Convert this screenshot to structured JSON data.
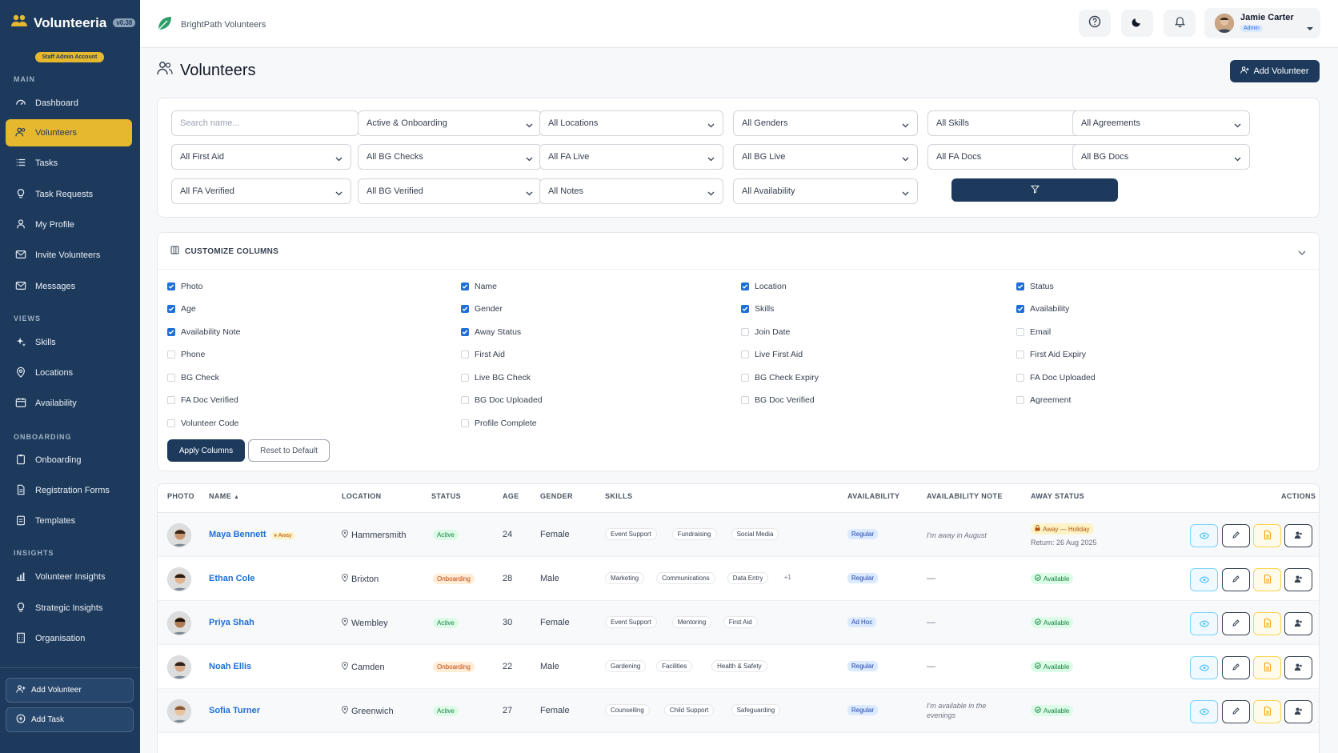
{
  "app": {
    "name": "Volunteeria",
    "version": "v0.38",
    "account_badge": "Staff Admin Account",
    "org_name": "BrightPath Volunteers"
  },
  "user": {
    "name": "Jamie Carter",
    "role": "Admin"
  },
  "sidebar": {
    "sections": [
      "MAIN",
      "VIEWS",
      "ONBOARDING",
      "INSIGHTS"
    ],
    "items": [
      {
        "label": "Dashboard",
        "icon": "dashboard-icon",
        "active": false
      },
      {
        "label": "Volunteers",
        "icon": "users-icon",
        "active": true
      },
      {
        "label": "Tasks",
        "icon": "list-icon",
        "active": false
      },
      {
        "label": "Task Requests",
        "icon": "bulb-icon",
        "active": false
      },
      {
        "label": "My Profile",
        "icon": "user-icon",
        "active": false
      },
      {
        "label": "Invite Volunteers",
        "icon": "invite-icon",
        "active": false
      },
      {
        "label": "Messages",
        "icon": "mail-icon",
        "active": false
      },
      {
        "label": "Skills",
        "icon": "sparkle-icon",
        "active": false
      },
      {
        "label": "Locations",
        "icon": "pin-icon",
        "active": false
      },
      {
        "label": "Availability",
        "icon": "calendar-icon",
        "active": false
      },
      {
        "label": "Onboarding",
        "icon": "clipboard-icon",
        "active": false
      },
      {
        "label": "Registration Forms",
        "icon": "file-icon",
        "active": false
      },
      {
        "label": "Templates",
        "icon": "clipboard-list-icon",
        "active": false
      },
      {
        "label": "Volunteer Insights",
        "icon": "bar-chart-icon",
        "active": false
      },
      {
        "label": "Strategic Insights",
        "icon": "bulb-icon",
        "active": false
      },
      {
        "label": "Organisation",
        "icon": "building-icon",
        "active": false
      }
    ],
    "buttons": [
      "Add Volunteer",
      "Add Task"
    ]
  },
  "page": {
    "title": "Volunteers",
    "add_button": "Add Volunteer"
  },
  "filters": {
    "search_placeholder": "Search name...",
    "selects": [
      "Active & Onboarding",
      "All Locations",
      "All Genders",
      "All Skills",
      "All Agreements",
      "All First Aid",
      "All BG Checks",
      "All FA Live",
      "All BG Live",
      "All FA Docs",
      "All BG Docs",
      "All FA Verified",
      "All BG Verified",
      "All Notes",
      "All Availability"
    ]
  },
  "columns_panel": {
    "title": "CUSTOMIZE COLUMNS",
    "options": [
      {
        "label": "Photo",
        "checked": true
      },
      {
        "label": "Name",
        "checked": true
      },
      {
        "label": "Location",
        "checked": true
      },
      {
        "label": "Status",
        "checked": true
      },
      {
        "label": "Age",
        "checked": true
      },
      {
        "label": "Gender",
        "checked": true
      },
      {
        "label": "Skills",
        "checked": true
      },
      {
        "label": "Availability",
        "checked": true
      },
      {
        "label": "Availability Note",
        "checked": true
      },
      {
        "label": "Away Status",
        "checked": true
      },
      {
        "label": "Join Date",
        "checked": false
      },
      {
        "label": "Email",
        "checked": false
      },
      {
        "label": "Phone",
        "checked": false
      },
      {
        "label": "First Aid",
        "checked": false
      },
      {
        "label": "Live First Aid",
        "checked": false
      },
      {
        "label": "First Aid Expiry",
        "checked": false
      },
      {
        "label": "BG Check",
        "checked": false
      },
      {
        "label": "Live BG Check",
        "checked": false
      },
      {
        "label": "BG Check Expiry",
        "checked": false
      },
      {
        "label": "FA Doc Uploaded",
        "checked": false
      },
      {
        "label": "FA Doc Verified",
        "checked": false
      },
      {
        "label": "BG Doc Uploaded",
        "checked": false
      },
      {
        "label": "BG Doc Verified",
        "checked": false
      },
      {
        "label": "Agreement",
        "checked": false
      },
      {
        "label": "Volunteer Code",
        "checked": false
      },
      {
        "label": "Profile Complete",
        "checked": false
      }
    ],
    "apply_label": "Apply Columns",
    "reset_label": "Reset to Default"
  },
  "table": {
    "headers": [
      "PHOTO",
      "NAME",
      "LOCATION",
      "STATUS",
      "AGE",
      "GENDER",
      "SKILLS",
      "AVAILABILITY",
      "AVAILABILITY NOTE",
      "AWAY STATUS",
      "ACTIONS"
    ],
    "sort_indicator": "▲",
    "rows": [
      {
        "name": "Maya Bennett",
        "tag": "Away",
        "location": "Hammersmith",
        "status": "Active",
        "age": "24",
        "gender": "Female",
        "skills": [
          "Event Support",
          "Fundraising",
          "Social Media"
        ],
        "more": "",
        "availability": "Regular",
        "note": "I'm away in August",
        "away": "Away — Holiday",
        "return": "Return: 26 Aug 2025"
      },
      {
        "name": "Ethan Cole",
        "tag": "",
        "location": "Brixton",
        "status": "Onboarding",
        "age": "28",
        "gender": "Male",
        "skills": [
          "Marketing",
          "Communications",
          "Data Entry"
        ],
        "more": "+1",
        "availability": "Regular",
        "note": "—",
        "away": "Available",
        "return": ""
      },
      {
        "name": "Priya Shah",
        "tag": "",
        "location": "Wembley",
        "status": "Active",
        "age": "30",
        "gender": "Female",
        "skills": [
          "Event Support",
          "Mentoring",
          "First Aid"
        ],
        "more": "",
        "availability": "Ad Hoc",
        "note": "—",
        "away": "Available",
        "return": ""
      },
      {
        "name": "Noah Ellis",
        "tag": "",
        "location": "Camden",
        "status": "Onboarding",
        "age": "22",
        "gender": "Male",
        "skills": [
          "Gardening",
          "Facilities",
          "Health & Safety"
        ],
        "more": "",
        "availability": "Regular",
        "note": "—",
        "away": "Available",
        "return": ""
      },
      {
        "name": "Sofia Turner",
        "tag": "",
        "location": "Greenwich",
        "status": "Active",
        "age": "27",
        "gender": "Female",
        "skills": [
          "Counselling",
          "Child Support",
          "Safeguarding"
        ],
        "more": "",
        "availability": "Regular",
        "note": "I'm available in the evenings",
        "away": "Available",
        "return": ""
      }
    ]
  },
  "colors": {
    "sidebar": "#1d3a5c",
    "accent": "#e6b82e",
    "link": "#1f6fd6",
    "primary_button": "#1d3a5c"
  }
}
